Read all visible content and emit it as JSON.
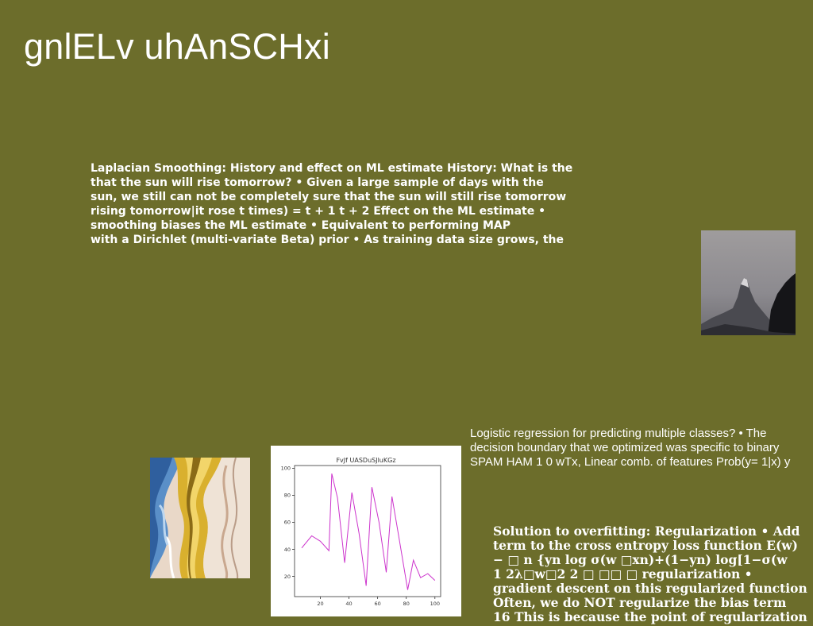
{
  "slide": {
    "title": "gnlELv uhAnSCHxi",
    "block1": {
      "lines": [
        "Laplacian Smoothing: History and effect on ML estimate History: What is the",
        "that the sun will rise tomorrow? • Given a large sample of days with the",
        "sun, we still can not be completely sure that the sun will still rise tomorrow",
        "rising tomorrow|it rose t times) = t + 1 t + 2 Effect on the ML estimate •",
        "smoothing biases the ML estimate • Equivalent to performing MAP",
        "with a Dirichlet (multi-variate Beta) prior • As training data size grows, the"
      ]
    },
    "block2": {
      "lines": [
        "Logistic regression for predicting multiple classes? • The",
        "decision boundary that we optimized was specific to binary",
        "SPAM HAM 1 0 wTx, Linear comb. of features Prob(y= 1|x) y"
      ]
    },
    "block3": {
      "lines": [
        "Solution to overfitting: Regularization • Add",
        "term to the cross entropy loss function E(w)",
        "− □ n {yn log σ(w □xn)+(1−yn) log[1−σ(w",
        "1 2λ□w□2 2 □ □□ □ regularization •",
        "gradient descent on this regularized function",
        "Often, we do NOT regularize the bias term",
        "16 This is because the point of regularization"
      ]
    }
  },
  "images": {
    "mountain": "mountain-photo",
    "swirl": "abstract-swirl-art"
  },
  "chart_data": {
    "type": "line",
    "title": "FvJf UASDuSJluKGz",
    "x": [
      7,
      14,
      20,
      26,
      27,
      32,
      38,
      43,
      48,
      53,
      58,
      64,
      69,
      75,
      80,
      85,
      90,
      96,
      101
    ],
    "series": [
      {
        "values": [
          41,
          50,
          46,
          39,
          96,
          78,
          30,
          82,
          52,
          13,
          86,
          60,
          23,
          79,
          48,
          10,
          32,
          19,
          22,
          17
        ]
      }
    ],
    "x_values_full": [
      7,
      14,
      20,
      26,
      28,
      32,
      37,
      42,
      47,
      52,
      56,
      61,
      66,
      70,
      75,
      81,
      85,
      90,
      95,
      100
    ],
    "xticks": [
      "20",
      "40",
      "60",
      "80",
      "100"
    ],
    "yticks": [
      "20",
      "40",
      "60",
      "80",
      "100"
    ],
    "xlim": [
      2,
      104
    ],
    "ylim": [
      5,
      102
    ],
    "color": "#cc33cc",
    "grid": false
  }
}
